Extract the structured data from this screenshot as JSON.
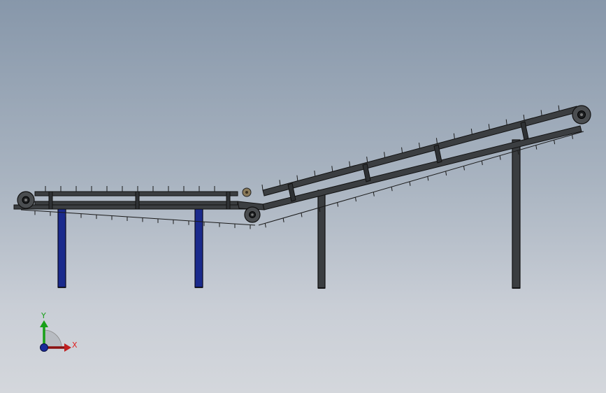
{
  "view": {
    "background_top": "#8797aa",
    "background_bottom": "#d4d7dc"
  },
  "model": {
    "frame_color": "#3b3e41",
    "frame_edge": "#111111",
    "leg_color_front": "#1a2a8c",
    "leg_color_rear": "#3a3d40",
    "roller_color": "#4a4d50",
    "idler_color": "#8a7a5a"
  },
  "triad": {
    "x_label": "X",
    "y_label": "Y",
    "x_color": "#e02020",
    "y_color": "#18a018",
    "z_color": "#1a2a9a"
  }
}
